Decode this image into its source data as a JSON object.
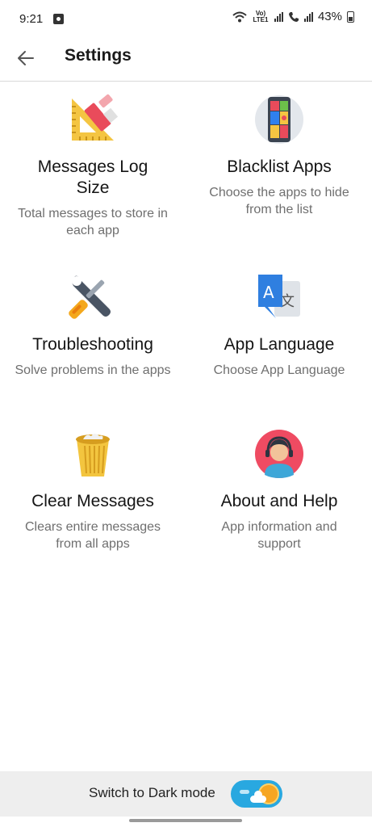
{
  "status_bar": {
    "time": "9:21",
    "network_label": "Vo) LTE1",
    "battery_percent": "43%"
  },
  "app_bar": {
    "title": "Settings"
  },
  "tiles": [
    {
      "title": "Messages Log Size",
      "subtitle": "Total messages to store in each app",
      "icon": "ruler-triangle-icon"
    },
    {
      "title": "Blacklist Apps",
      "subtitle": "Choose the apps to hide from the list",
      "icon": "phone-apps-icon"
    },
    {
      "title": "Troubleshooting",
      "subtitle": "Solve problems in the apps",
      "icon": "wrench-screwdriver-icon"
    },
    {
      "title": "App Language",
      "subtitle": "Choose App Language",
      "icon": "translate-icon"
    },
    {
      "title": "Clear Messages",
      "subtitle": "Clears entire messages from all apps",
      "icon": "trash-bin-icon"
    },
    {
      "title": "About and Help",
      "subtitle": "App information and support",
      "icon": "support-agent-icon"
    }
  ],
  "bottom": {
    "dark_mode_label": "Switch to Dark mode",
    "dark_mode_enabled": false
  },
  "colors": {
    "toggle_track": "#29a8e0",
    "toggle_sun": "#f6a623",
    "bottom_bar": "#eeeeee"
  }
}
